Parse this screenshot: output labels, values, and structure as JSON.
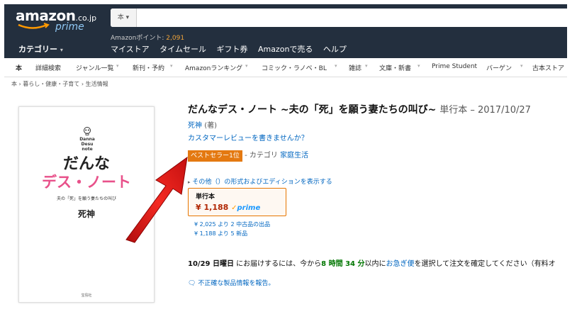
{
  "header": {
    "logo_text": "amazon",
    "logo_tld": ".co.jp",
    "logo_prime": "prime",
    "search_category": "本",
    "categories_label": "カテゴリー",
    "points_label": "Amazonポイント: ",
    "points_value": "2,091",
    "nav_links": [
      "マイストア",
      "タイムセール",
      "ギフト券",
      "Amazonで売る",
      "ヘルプ"
    ]
  },
  "subnav": {
    "items": [
      "本",
      "詳細検索",
      "ジャンル一覧",
      "新刊・予約",
      "Amazonランキング",
      "コミック・ラノベ・BL",
      "雑誌",
      "文庫・新書",
      "Prime Student",
      "バーゲン",
      "古本ストア"
    ]
  },
  "breadcrumb": "本 › 暮らし・健康・子育て › 生活情報",
  "cover": {
    "logo": "Danna Desu note",
    "title_line1": "だんな",
    "title_line2": "デス・ノート",
    "subtitle": "夫の「死」を願う妻たちの叫び",
    "author": "死神",
    "publisher": "宝島社"
  },
  "product": {
    "title": "だんなデス・ノート ~夫の「死」を願う妻たちの叫び~",
    "meta": "単行本 – 2017/10/27",
    "author_name": "死神",
    "author_role": "(著)",
    "review_link": "カスタマーレビューを書きませんか？",
    "bestseller_badge": "ベストセラー1位",
    "bestseller_prefix": "- カテゴリ",
    "bestseller_category": "家庭生活",
    "editions_link": "その他（）の形式およびエディションを表示する",
    "edition_label": "単行本",
    "edition_price": "¥ 1,188",
    "prime_label": "prime",
    "offer_used": "¥ 2,025 より 2 中古品の出品",
    "offer_new": "¥ 1,188 より 5 新品",
    "delivery_date": "10/29 日曜日",
    "delivery_text1": " にお届けするには、今から",
    "delivery_time": "8 時間 34 分",
    "delivery_text2": "以内に",
    "delivery_link": "お急ぎ便",
    "delivery_text3": "を選択して注文を確定してください（有料オ",
    "report_link": "不正確な製品情報を報告。"
  },
  "colors": {
    "header_bg": "#232f3e",
    "link": "#0066c0",
    "badge": "#e47911",
    "price": "#b12704",
    "arrow": "#e8201c"
  }
}
